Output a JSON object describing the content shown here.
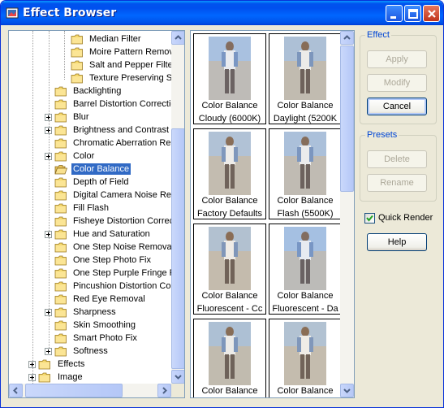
{
  "window": {
    "title": "Effect Browser",
    "accent": "#0053ee",
    "selection_color": "#316ac5"
  },
  "tree": {
    "items": [
      {
        "label": "Median Filter",
        "level": 3,
        "expandable": false
      },
      {
        "label": "Moire Pattern Remov",
        "level": 3,
        "expandable": false
      },
      {
        "label": "Salt and Pepper Filter",
        "level": 3,
        "expandable": false
      },
      {
        "label": "Texture Preserving Sr",
        "level": 3,
        "expandable": false
      },
      {
        "label": "Backlighting",
        "level": 2,
        "expandable": false
      },
      {
        "label": "Barrel Distortion Correction",
        "level": 2,
        "expandable": false
      },
      {
        "label": "Blur",
        "level": 2,
        "expandable": true
      },
      {
        "label": "Brightness and Contrast",
        "level": 2,
        "expandable": true
      },
      {
        "label": "Chromatic Aberration Rem",
        "level": 2,
        "expandable": false
      },
      {
        "label": "Color",
        "level": 2,
        "expandable": true
      },
      {
        "label": "Color Balance",
        "level": 2,
        "expandable": false,
        "selected": true
      },
      {
        "label": "Depth of Field",
        "level": 2,
        "expandable": false
      },
      {
        "label": "Digital Camera Noise Rem",
        "level": 2,
        "expandable": false
      },
      {
        "label": "Fill Flash",
        "level": 2,
        "expandable": false
      },
      {
        "label": "Fisheye Distortion Correct",
        "level": 2,
        "expandable": false
      },
      {
        "label": "Hue and Saturation",
        "level": 2,
        "expandable": true
      },
      {
        "label": "One Step Noise Removal",
        "level": 2,
        "expandable": false
      },
      {
        "label": "One Step Photo Fix",
        "level": 2,
        "expandable": false
      },
      {
        "label": "One Step Purple Fringe Fi",
        "level": 2,
        "expandable": false
      },
      {
        "label": "Pincushion Distortion Corr",
        "level": 2,
        "expandable": false
      },
      {
        "label": "Red Eye Removal",
        "level": 2,
        "expandable": false
      },
      {
        "label": "Sharpness",
        "level": 2,
        "expandable": true
      },
      {
        "label": "Skin Smoothing",
        "level": 2,
        "expandable": false
      },
      {
        "label": "Smart Photo Fix",
        "level": 2,
        "expandable": false
      },
      {
        "label": "Softness",
        "level": 2,
        "expandable": true
      },
      {
        "label": "Effects",
        "level": 1,
        "expandable": true
      },
      {
        "label": "Image",
        "level": 1,
        "expandable": true
      }
    ]
  },
  "presets_grid": {
    "cells": [
      {
        "line1": "Color Balance",
        "line2": "Cloudy (6000K)",
        "tint": "#cfd9ec"
      },
      {
        "line1": "Color Balance",
        "line2": "Daylight (5200K",
        "tint": "#ddd7cf"
      },
      {
        "line1": "Color Balance",
        "line2": "Factory Defaults",
        "tint": "#e5dbcf"
      },
      {
        "line1": "Color Balance",
        "line2": "Flash (5500K)",
        "tint": "#d6d8dc"
      },
      {
        "line1": "Color Balance",
        "line2": "Fluorescent - Cc",
        "tint": "#e8d9c4"
      },
      {
        "line1": "Color Balance",
        "line2": "Fluorescent - Da",
        "tint": "#c8d8ee"
      },
      {
        "line1": "Color Balance",
        "line2": "",
        "tint": "#dcd6cc"
      },
      {
        "line1": "Color Balance",
        "line2": "",
        "tint": "#e9dcc6"
      }
    ]
  },
  "effect_group": {
    "title": "Effect",
    "apply_label": "Apply",
    "modify_label": "Modify",
    "cancel_label": "Cancel"
  },
  "presets_group": {
    "title": "Presets",
    "delete_label": "Delete",
    "rename_label": "Rename"
  },
  "quick_render": {
    "label": "Quick Render",
    "checked": true
  },
  "help_label": "Help"
}
